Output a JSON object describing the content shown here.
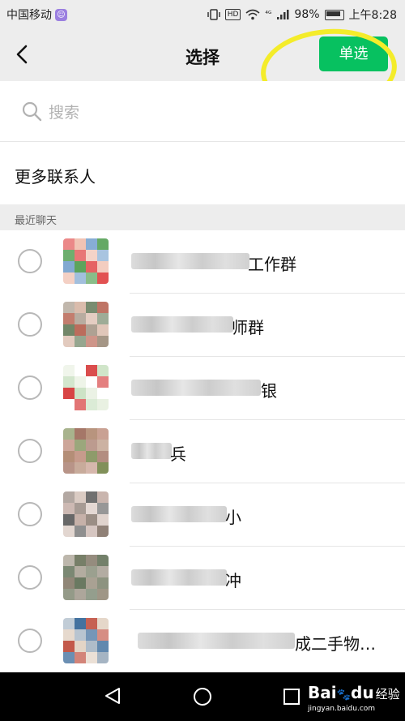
{
  "status_bar": {
    "carrier": "中国移动",
    "carrier_badge": "☺",
    "hd": "HD",
    "signal": "⁴ᴳ",
    "battery_percent": "98%",
    "time": "上午8:28"
  },
  "header": {
    "title": "选择",
    "action_label": "单选"
  },
  "search": {
    "placeholder": "搜索"
  },
  "more_contacts": {
    "label": "更多联系人"
  },
  "section": {
    "title": "最近聊天"
  },
  "contacts": [
    {
      "name_visible": "工作群",
      "avatar_colors": [
        "#e04848",
        "#4a9a4a",
        "#7aa4cf",
        "#f0c0b0"
      ]
    },
    {
      "name_visible": "师群",
      "avatar_colors": [
        "#b45c4a",
        "#6a8060",
        "#d8b8a8",
        "#a09080"
      ]
    },
    {
      "name_visible": "银",
      "avatar_colors": [
        "#d63a3a",
        "#ffffff",
        "#e8f0e0",
        "#c8e0c0"
      ]
    },
    {
      "name_visible": "兵",
      "avatar_colors": [
        "#a07060",
        "#7a8a50",
        "#c09080",
        "#b08870"
      ]
    },
    {
      "name_visible": "小",
      "avatar_colors": [
        "#8a7a70",
        "#c0a8a0",
        "#606060",
        "#d8c8c0"
      ]
    },
    {
      "name_visible": "冲",
      "avatar_colors": [
        "#5a6a50",
        "#8a8070",
        "#707860",
        "#9a9080"
      ]
    },
    {
      "name_visible": "成二手物…",
      "avatar_colors": [
        "#c05040",
        "#3a6a9a",
        "#a0b0c0",
        "#e0d0c0"
      ]
    }
  ],
  "system_nav": {
    "watermark_brand": "Bai",
    "watermark_paw": "🐾",
    "watermark_tail": "du",
    "watermark_cn": "经验",
    "watermark_url": "jingyan.baidu.com"
  },
  "colors": {
    "accent": "#07c160",
    "highlight": "#f4ec2a",
    "header_bg": "#ededed"
  }
}
